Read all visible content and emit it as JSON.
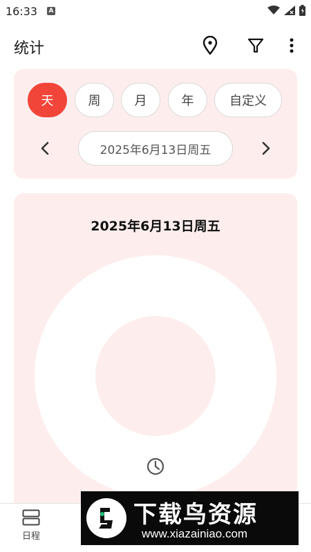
{
  "status_bar": {
    "time": "16:33",
    "a_badge": "A"
  },
  "app_bar": {
    "title": "统计",
    "icons": [
      "location-pin-icon",
      "filter-icon",
      "more-vert-icon"
    ]
  },
  "filter": {
    "chips": [
      {
        "label": "天",
        "active": true
      },
      {
        "label": "周",
        "active": false
      },
      {
        "label": "月",
        "active": false
      },
      {
        "label": "年",
        "active": false
      },
      {
        "label": "自定义",
        "active": false
      }
    ],
    "current_date": "2025年6月13日周五"
  },
  "chart": {
    "title": "2025年6月13日周五",
    "center_icon": "clock-icon"
  },
  "bottom_nav": {
    "items": [
      {
        "label": "日程",
        "icon": "schedule-list-icon"
      }
    ]
  },
  "watermark": {
    "title": "下载鸟资源",
    "url": "www.xiazainiao.com"
  },
  "colors": {
    "accent": "#f2453a",
    "card_bg": "#fdeeed"
  }
}
